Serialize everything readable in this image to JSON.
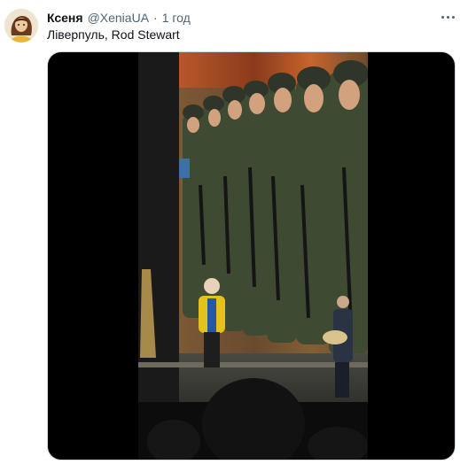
{
  "tweet": {
    "display_name": "Ксеня",
    "handle": "@XeniaUA",
    "separator": "·",
    "timestamp": "1 год",
    "text": "Ліверпуль, Rod Stewart"
  },
  "icons": {
    "more": "more-horizontal-icon"
  },
  "colors": {
    "name": "#0f1419",
    "secondary": "#536471",
    "media_background": "#000000"
  }
}
